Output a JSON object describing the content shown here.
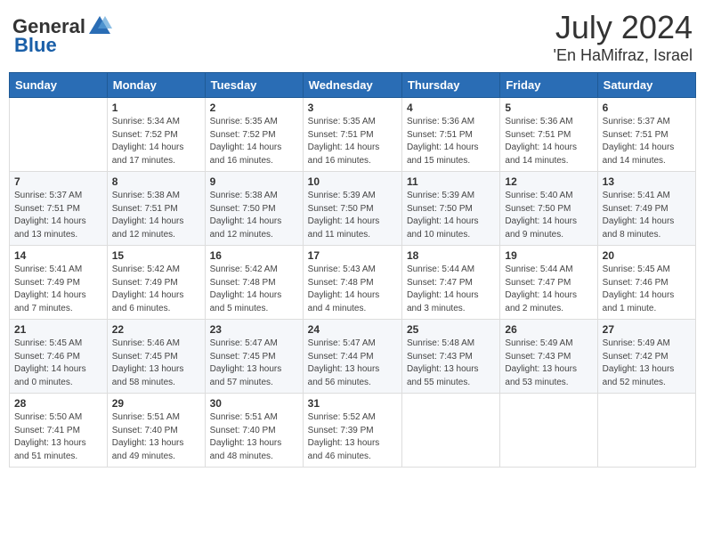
{
  "header": {
    "logo_general": "General",
    "logo_blue": "Blue",
    "month": "July 2024",
    "location": "'En HaMifraz, Israel"
  },
  "columns": [
    "Sunday",
    "Monday",
    "Tuesday",
    "Wednesday",
    "Thursday",
    "Friday",
    "Saturday"
  ],
  "weeks": [
    [
      {
        "date": "",
        "info": ""
      },
      {
        "date": "1",
        "info": "Sunrise: 5:34 AM\nSunset: 7:52 PM\nDaylight: 14 hours\nand 17 minutes."
      },
      {
        "date": "2",
        "info": "Sunrise: 5:35 AM\nSunset: 7:52 PM\nDaylight: 14 hours\nand 16 minutes."
      },
      {
        "date": "3",
        "info": "Sunrise: 5:35 AM\nSunset: 7:51 PM\nDaylight: 14 hours\nand 16 minutes."
      },
      {
        "date": "4",
        "info": "Sunrise: 5:36 AM\nSunset: 7:51 PM\nDaylight: 14 hours\nand 15 minutes."
      },
      {
        "date": "5",
        "info": "Sunrise: 5:36 AM\nSunset: 7:51 PM\nDaylight: 14 hours\nand 14 minutes."
      },
      {
        "date": "6",
        "info": "Sunrise: 5:37 AM\nSunset: 7:51 PM\nDaylight: 14 hours\nand 14 minutes."
      }
    ],
    [
      {
        "date": "7",
        "info": "Sunrise: 5:37 AM\nSunset: 7:51 PM\nDaylight: 14 hours\nand 13 minutes."
      },
      {
        "date": "8",
        "info": "Sunrise: 5:38 AM\nSunset: 7:51 PM\nDaylight: 14 hours\nand 12 minutes."
      },
      {
        "date": "9",
        "info": "Sunrise: 5:38 AM\nSunset: 7:50 PM\nDaylight: 14 hours\nand 12 minutes."
      },
      {
        "date": "10",
        "info": "Sunrise: 5:39 AM\nSunset: 7:50 PM\nDaylight: 14 hours\nand 11 minutes."
      },
      {
        "date": "11",
        "info": "Sunrise: 5:39 AM\nSunset: 7:50 PM\nDaylight: 14 hours\nand 10 minutes."
      },
      {
        "date": "12",
        "info": "Sunrise: 5:40 AM\nSunset: 7:50 PM\nDaylight: 14 hours\nand 9 minutes."
      },
      {
        "date": "13",
        "info": "Sunrise: 5:41 AM\nSunset: 7:49 PM\nDaylight: 14 hours\nand 8 minutes."
      }
    ],
    [
      {
        "date": "14",
        "info": "Sunrise: 5:41 AM\nSunset: 7:49 PM\nDaylight: 14 hours\nand 7 minutes."
      },
      {
        "date": "15",
        "info": "Sunrise: 5:42 AM\nSunset: 7:49 PM\nDaylight: 14 hours\nand 6 minutes."
      },
      {
        "date": "16",
        "info": "Sunrise: 5:42 AM\nSunset: 7:48 PM\nDaylight: 14 hours\nand 5 minutes."
      },
      {
        "date": "17",
        "info": "Sunrise: 5:43 AM\nSunset: 7:48 PM\nDaylight: 14 hours\nand 4 minutes."
      },
      {
        "date": "18",
        "info": "Sunrise: 5:44 AM\nSunset: 7:47 PM\nDaylight: 14 hours\nand 3 minutes."
      },
      {
        "date": "19",
        "info": "Sunrise: 5:44 AM\nSunset: 7:47 PM\nDaylight: 14 hours\nand 2 minutes."
      },
      {
        "date": "20",
        "info": "Sunrise: 5:45 AM\nSunset: 7:46 PM\nDaylight: 14 hours\nand 1 minute."
      }
    ],
    [
      {
        "date": "21",
        "info": "Sunrise: 5:45 AM\nSunset: 7:46 PM\nDaylight: 14 hours\nand 0 minutes."
      },
      {
        "date": "22",
        "info": "Sunrise: 5:46 AM\nSunset: 7:45 PM\nDaylight: 13 hours\nand 58 minutes."
      },
      {
        "date": "23",
        "info": "Sunrise: 5:47 AM\nSunset: 7:45 PM\nDaylight: 13 hours\nand 57 minutes."
      },
      {
        "date": "24",
        "info": "Sunrise: 5:47 AM\nSunset: 7:44 PM\nDaylight: 13 hours\nand 56 minutes."
      },
      {
        "date": "25",
        "info": "Sunrise: 5:48 AM\nSunset: 7:43 PM\nDaylight: 13 hours\nand 55 minutes."
      },
      {
        "date": "26",
        "info": "Sunrise: 5:49 AM\nSunset: 7:43 PM\nDaylight: 13 hours\nand 53 minutes."
      },
      {
        "date": "27",
        "info": "Sunrise: 5:49 AM\nSunset: 7:42 PM\nDaylight: 13 hours\nand 52 minutes."
      }
    ],
    [
      {
        "date": "28",
        "info": "Sunrise: 5:50 AM\nSunset: 7:41 PM\nDaylight: 13 hours\nand 51 minutes."
      },
      {
        "date": "29",
        "info": "Sunrise: 5:51 AM\nSunset: 7:40 PM\nDaylight: 13 hours\nand 49 minutes."
      },
      {
        "date": "30",
        "info": "Sunrise: 5:51 AM\nSunset: 7:40 PM\nDaylight: 13 hours\nand 48 minutes."
      },
      {
        "date": "31",
        "info": "Sunrise: 5:52 AM\nSunset: 7:39 PM\nDaylight: 13 hours\nand 46 minutes."
      },
      {
        "date": "",
        "info": ""
      },
      {
        "date": "",
        "info": ""
      },
      {
        "date": "",
        "info": ""
      }
    ]
  ]
}
